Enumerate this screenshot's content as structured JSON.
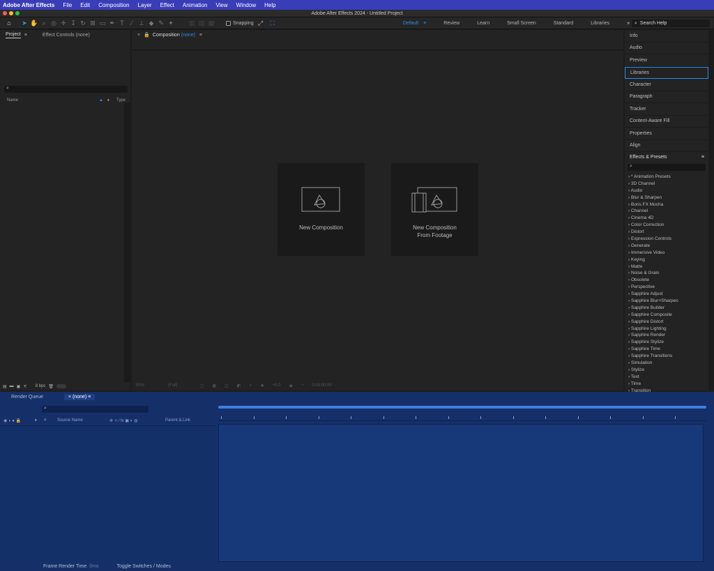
{
  "menubar": {
    "app": "Adobe After Effects",
    "items": [
      "File",
      "Edit",
      "Composition",
      "Layer",
      "Effect",
      "Animation",
      "View",
      "Window",
      "Help"
    ]
  },
  "window": {
    "title": "Adobe After Effects 2024 - Untitled Project"
  },
  "toolbar": {
    "snapping": "Snapping",
    "workspaces": [
      "Default",
      "Review",
      "Learn",
      "Small Screen",
      "Standard",
      "Libraries"
    ],
    "active_workspace": "Default",
    "search_help": "Search Help"
  },
  "project": {
    "tab_project": "Project",
    "tab_effect_controls": "Effect Controls (none)",
    "col_name": "Name",
    "col_type": "Type",
    "bpc": "8 bpc"
  },
  "composition": {
    "tab_label": "Composition",
    "tab_value": "(none)",
    "new_comp": "New Composition",
    "new_comp_footage_1": "New Composition",
    "new_comp_footage_2": "From Footage",
    "zoom": "50%",
    "resolution": "(Full)",
    "exposure": "+0.0",
    "timecode": "0:00:00:00"
  },
  "right_panels": {
    "items": [
      "Info",
      "Audio",
      "Preview",
      "Libraries",
      "Character",
      "Paragraph",
      "Tracker",
      "Content-Aware Fill",
      "Properties",
      "Align"
    ],
    "active": "Libraries"
  },
  "effects_presets": {
    "title": "Effects & Presets",
    "items": [
      "* Animation Presets",
      "3D Channel",
      "Audio",
      "Blur & Sharpen",
      "Boris FX Mocha",
      "Channel",
      "Cinema 4D",
      "Color Correction",
      "Distort",
      "Expression Controls",
      "Generate",
      "Immersive Video",
      "Keying",
      "Matte",
      "Noise & Grain",
      "Obsolete",
      "Perspective",
      "Sapphire Adjust",
      "Sapphire Blur+Sharpen",
      "Sapphire Builder",
      "Sapphire Composite",
      "Sapphire Distort",
      "Sapphire Lighting",
      "Sapphire Render",
      "Sapphire Stylize",
      "Sapphire Time",
      "Sapphire Transitions",
      "Simulation",
      "Stylize",
      "Text",
      "Time",
      "Transition"
    ]
  },
  "timeline": {
    "tab_render_queue": "Render Queue",
    "tab_none": "(none)",
    "col_hash": "#",
    "col_source_name": "Source Name",
    "col_parent": "Parent & Link",
    "frame_render_time": "Frame Render Time",
    "frame_render_ms": "0ms",
    "toggle_switches": "Toggle Switches / Modes"
  }
}
